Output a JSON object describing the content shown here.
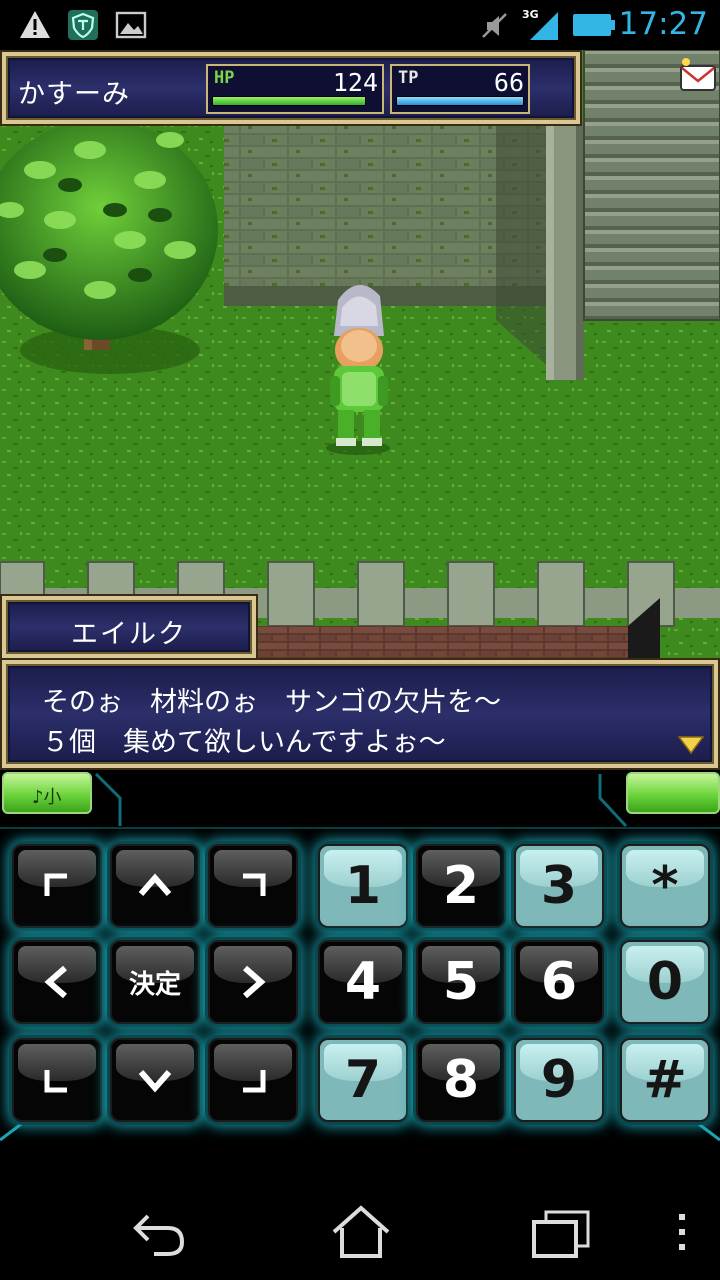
{
  "status_bar": {
    "icons": [
      "warning-icon",
      "shield-icon",
      "image-icon",
      "vibrate-icon",
      "signal-icon",
      "battery-icon"
    ],
    "network": "3G",
    "time": "17:27",
    "time_color": "#33b5e5"
  },
  "hud": {
    "character_name": "かすーみ",
    "hp_label": "HP",
    "hp_value": "124",
    "hp_fill": 1.0,
    "tp_label": "TP",
    "tp_value": "66",
    "tp_fill": 1.0,
    "mail_icon": "mail-icon"
  },
  "dialog": {
    "speaker": "エイルク",
    "lines": [
      "そのぉ　材料のぉ　サンゴの欠片を～",
      "５個　集めて欲しいんですよぉ～"
    ],
    "continue_icon": "triangle-down-icon"
  },
  "controller": {
    "sound_toggle": "♪小",
    "dpad": [
      {
        "icon": "arrow-up-left-icon"
      },
      {
        "icon": "arrow-up-icon"
      },
      {
        "icon": "arrow-up-right-icon"
      },
      {
        "icon": "arrow-left-icon"
      },
      {
        "label": "決定"
      },
      {
        "icon": "arrow-right-icon"
      },
      {
        "icon": "arrow-down-left-icon"
      },
      {
        "icon": "arrow-down-icon"
      },
      {
        "icon": "arrow-down-right-icon"
      }
    ],
    "keypad": [
      "1",
      "2",
      "3",
      "*",
      "4",
      "5",
      "6",
      "0",
      "7",
      "8",
      "9",
      "#"
    ]
  },
  "nav_bar": {
    "icons": [
      "back-icon",
      "home-icon",
      "recent-apps-icon",
      "overflow-menu-icon"
    ]
  },
  "colors": {
    "frame_border": "#d9c896",
    "frame_bg": "#2c2f6a",
    "hp_bar": "#2fb12a",
    "tp_bar": "#2a8fd6",
    "key_glow": "#1aa6b3",
    "key_teal": "#7fb8b8",
    "toggle_green": "#6dd43c"
  }
}
